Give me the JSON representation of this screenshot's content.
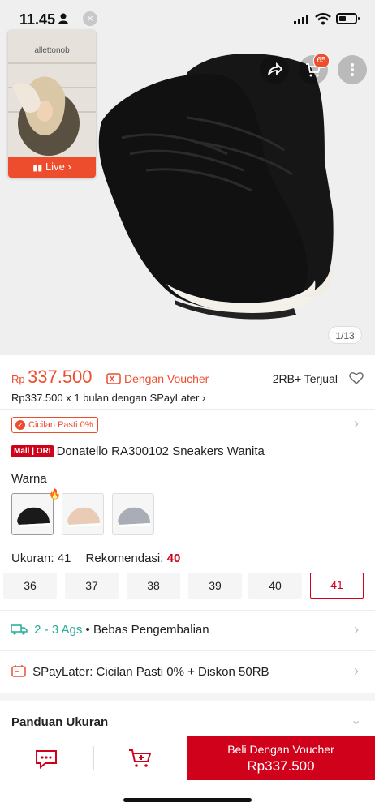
{
  "status_bar": {
    "time": "11.45",
    "battery_level": 0.45
  },
  "live": {
    "label": "Live",
    "brand": "allettonob"
  },
  "hero": {
    "pager": "1/13",
    "cart_count": "65"
  },
  "price": {
    "currency": "Rp",
    "amount": "337.500",
    "voucher_text": "Dengan Voucher",
    "sold": "2RB+ Terjual",
    "spaylater": "Rp337.500 x 1 bulan dengan SPayLater ›"
  },
  "cicilan_badge": "Cicilan Pasti 0%",
  "product": {
    "mall_badge": "Mall | ORI",
    "title": "Donatello RA300102 Sneakers Wanita"
  },
  "warna": {
    "label": "Warna",
    "colors": [
      "black",
      "beige",
      "grey"
    ],
    "swatch_hex": [
      "#1a1a1a",
      "#e9cbb6",
      "#a9aeb6"
    ]
  },
  "ukuran": {
    "label": "Ukuran: 41",
    "rekomendasi_label": "Rekomendasi:",
    "rekomendasi_value": "40"
  },
  "sizes": [
    "36",
    "37",
    "38",
    "39",
    "40",
    "41"
  ],
  "selected_size": "41",
  "shipping": {
    "days": "2 - 3 Ags",
    "sep": "•",
    "text": "Bebas Pengembalian"
  },
  "spaylater_row": "SPayLater: Cicilan Pasti 0% + Diskon 50RB",
  "panduan": "Panduan Ukuran",
  "buy_button": {
    "line1": "Beli Dengan Voucher",
    "line2": "Rp337.500"
  },
  "colors": {
    "accent": "#ee4d2d",
    "mall_red": "#d0011b",
    "shipping_green": "#26aa99"
  }
}
